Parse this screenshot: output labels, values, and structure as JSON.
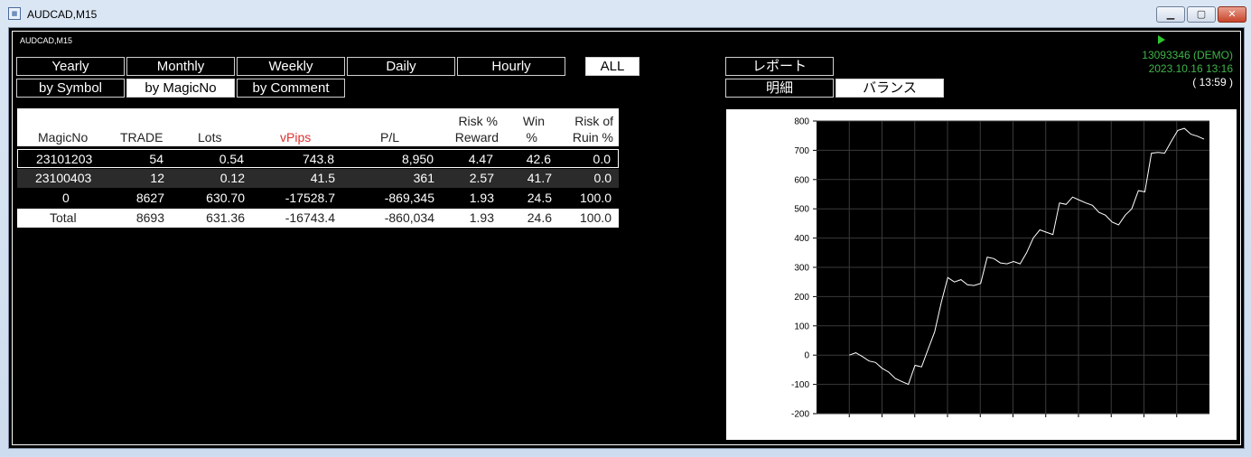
{
  "window": {
    "title": "AUDCAD,M15",
    "symbol_label": "AUDCAD,M15",
    "icon": "mt4-chart-icon"
  },
  "period_tabs": [
    {
      "label": "Yearly",
      "selected": false
    },
    {
      "label": "Monthly",
      "selected": false
    },
    {
      "label": "Weekly",
      "selected": false
    },
    {
      "label": "Daily",
      "selected": false
    },
    {
      "label": "Hourly",
      "selected": false
    },
    {
      "label": "ALL",
      "selected": true
    }
  ],
  "group_tabs": [
    {
      "label": "by Symbol",
      "selected": false
    },
    {
      "label": "by MagicNo",
      "selected": true
    },
    {
      "label": "by Comment",
      "selected": false
    }
  ],
  "view_tabs": [
    {
      "label": "レポート",
      "selected": false
    },
    {
      "label": "明細",
      "selected": false
    },
    {
      "label": "バランス",
      "selected": true
    }
  ],
  "account": {
    "number": "13093346 (DEMO)",
    "datetime": "2023.10.16 13:16",
    "elapsed": "( 13:59 )"
  },
  "colors": {
    "vpips_header": "#e03030",
    "account_text": "#3fb44a",
    "play_icon": "#2ec52e"
  },
  "table": {
    "headers": {
      "magicno": "MagicNo",
      "trade": "TRADE",
      "lots": "Lots",
      "vpips": "vPips",
      "pl": "P/L",
      "risk_reward_1": "Risk %",
      "risk_reward_2": "Reward",
      "win_1": "Win",
      "win_2": "%",
      "ruin_1": "Risk of",
      "ruin_2": "Ruin %"
    },
    "rows": [
      {
        "magicno": "23101203",
        "trade": "54",
        "lots": "0.54",
        "vpips": "743.8",
        "pl": "8,950",
        "rr": "4.47",
        "win": "42.6",
        "ruin": "0.0"
      },
      {
        "magicno": "23100403",
        "trade": "12",
        "lots": "0.12",
        "vpips": "41.5",
        "pl": "361",
        "rr": "2.57",
        "win": "41.7",
        "ruin": "0.0"
      },
      {
        "magicno": "0",
        "trade": "8627",
        "lots": "630.70",
        "vpips": "-17528.7",
        "pl": "-869,345",
        "rr": "1.93",
        "win": "24.5",
        "ruin": "100.0"
      }
    ],
    "total": {
      "magicno": "Total",
      "trade": "8693",
      "lots": "631.36",
      "vpips": "-16743.4",
      "pl": "-860,034",
      "rr": "1.93",
      "win": "24.6",
      "ruin": "100.0"
    }
  },
  "chart_data": {
    "type": "line",
    "title": "",
    "xlabel": "",
    "ylabel": "",
    "ylim": [
      -200,
      800
    ],
    "y_ticks": [
      "800",
      "700",
      "600",
      "500",
      "400",
      "300",
      "200",
      "100",
      "0",
      "-100",
      "-200"
    ],
    "grid": true,
    "series": [
      {
        "values": [
          0,
          8,
          -5,
          -20,
          -25,
          -45,
          -58,
          -80,
          -90,
          -100,
          -35,
          -40,
          20,
          80,
          180,
          265,
          250,
          258,
          240,
          238,
          245,
          335,
          330,
          315,
          312,
          320,
          312,
          350,
          400,
          428,
          420,
          412,
          520,
          515,
          540,
          530,
          520,
          512,
          488,
          478,
          455,
          445,
          478,
          500,
          562,
          558,
          690,
          693,
          690,
          730,
          768,
          775,
          755,
          748,
          738
        ]
      }
    ]
  }
}
